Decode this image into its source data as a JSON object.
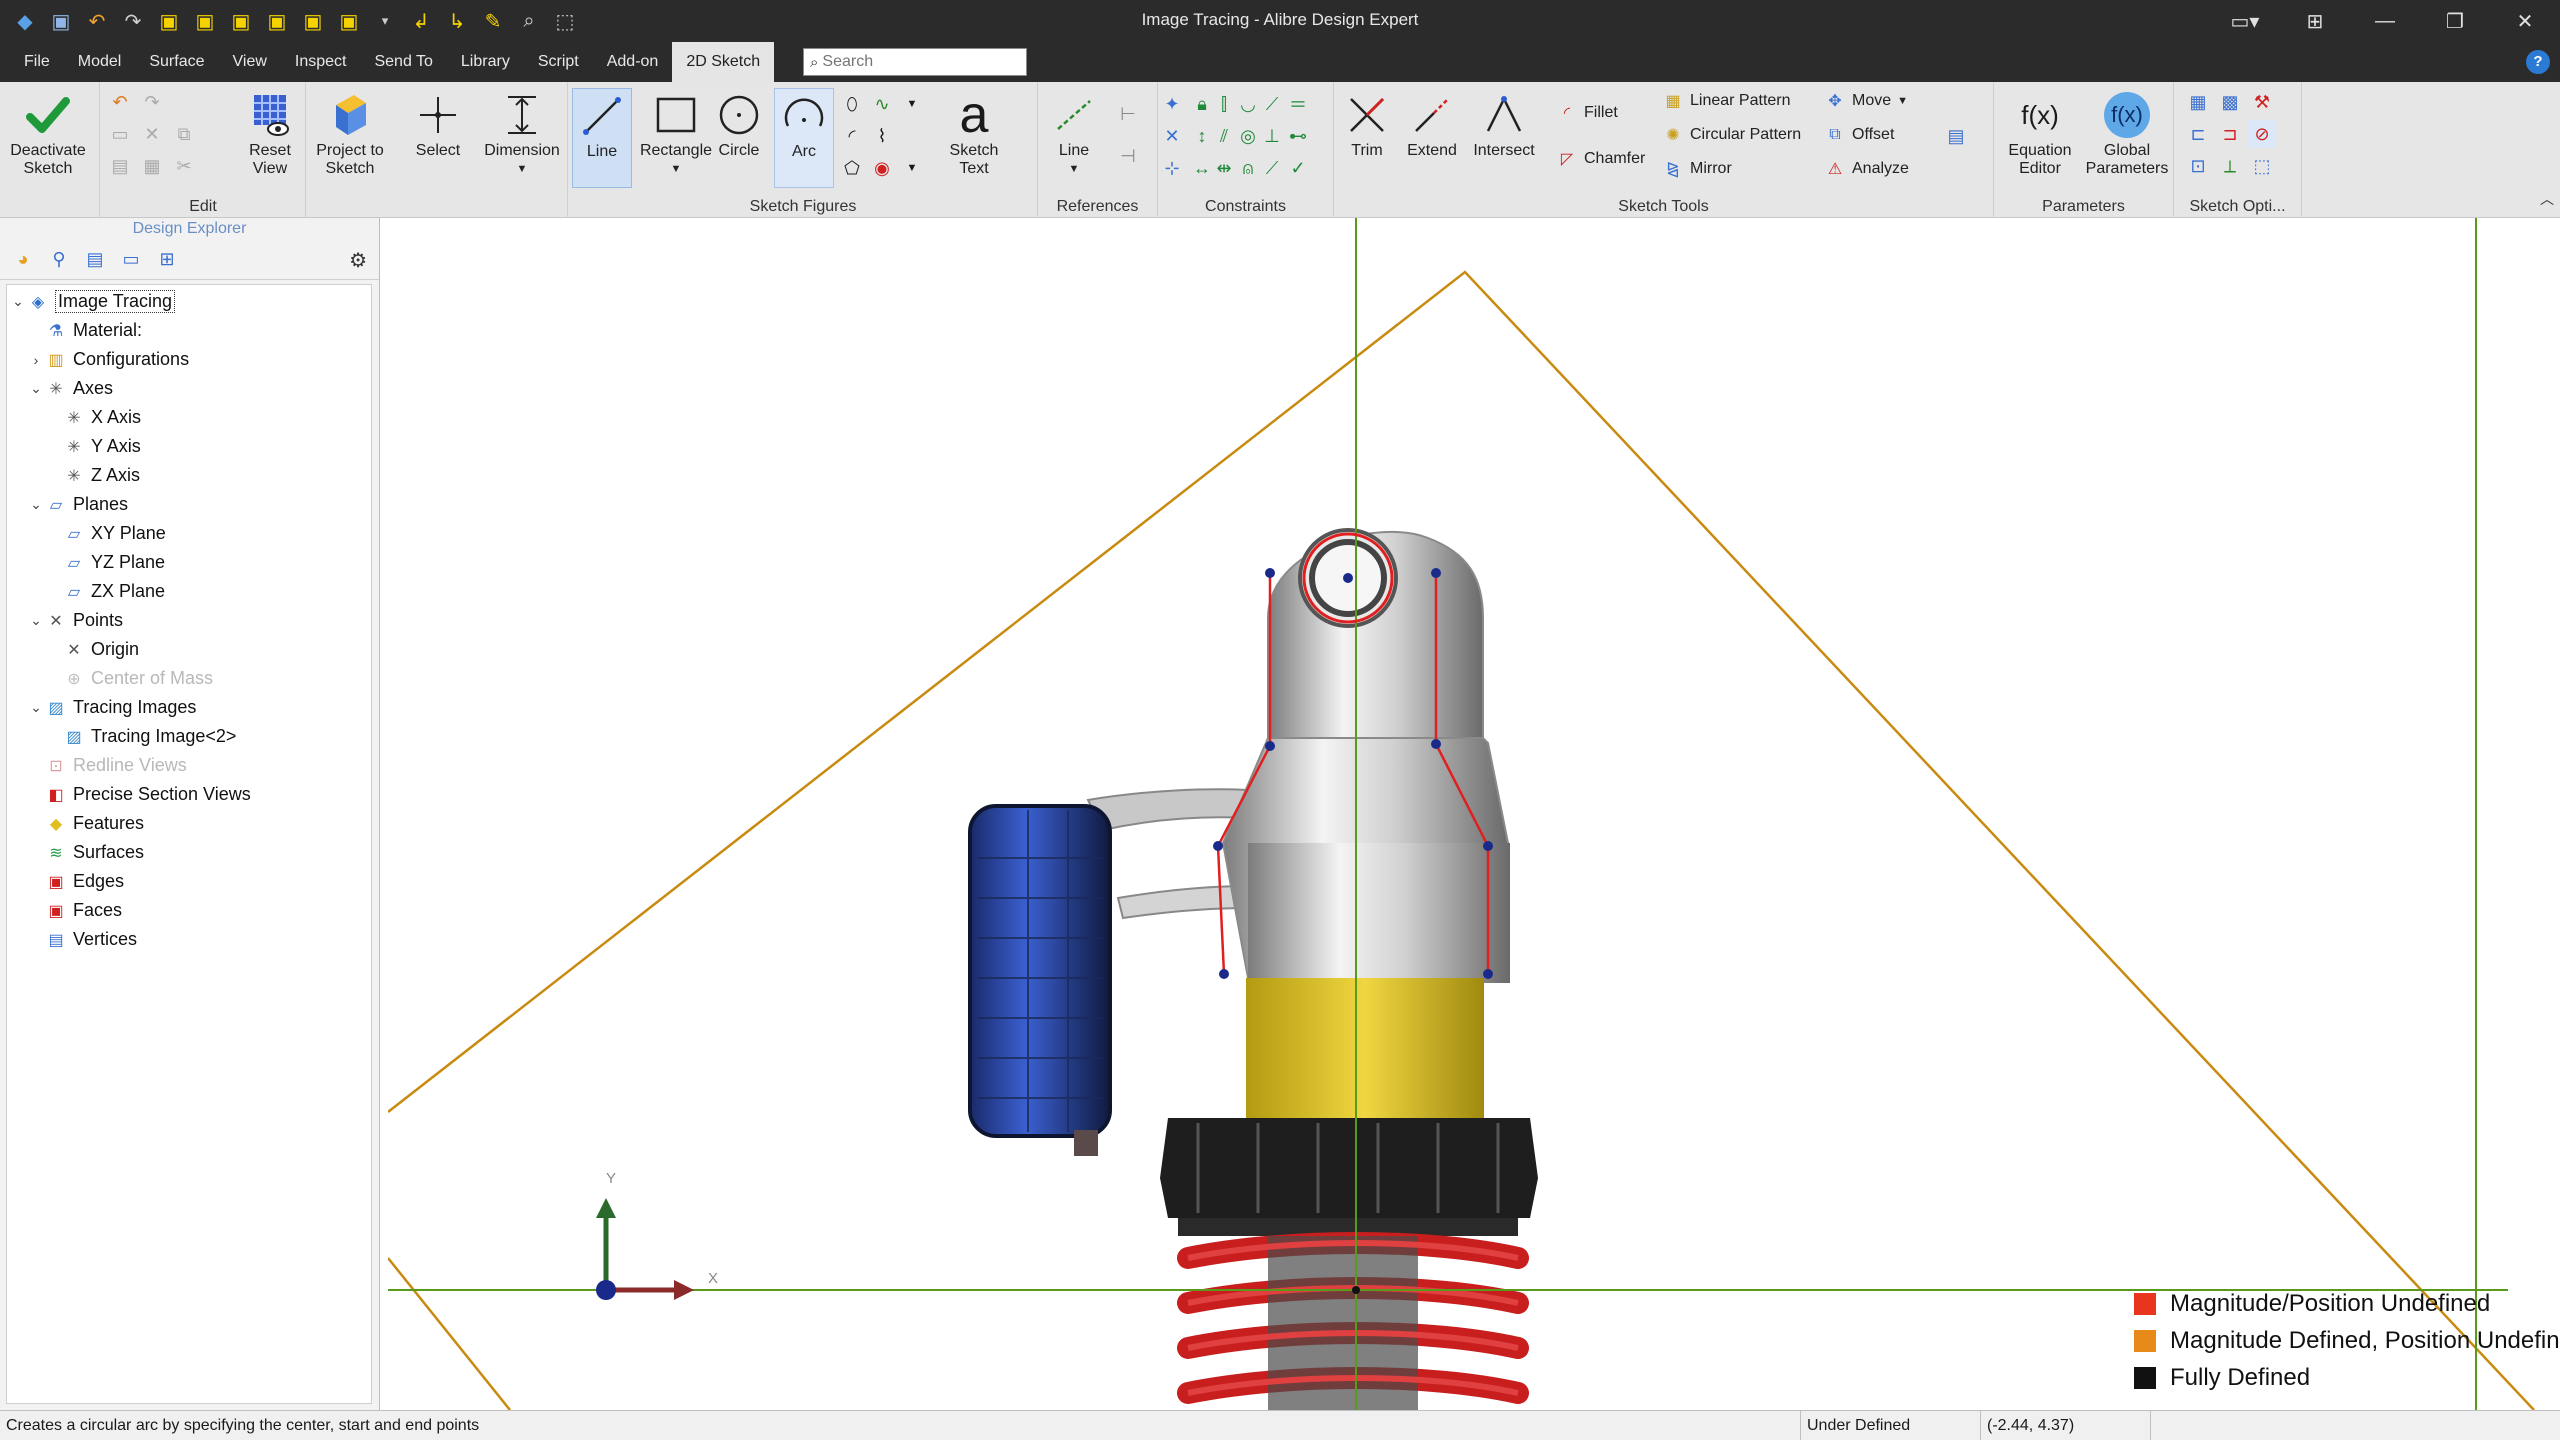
{
  "window": {
    "title": "Image Tracing - Alibre Design Expert"
  },
  "menu": {
    "tabs": [
      "File",
      "Model",
      "Surface",
      "View",
      "Inspect",
      "Send To",
      "Library",
      "Script",
      "Add-on",
      "2D Sketch"
    ],
    "active_tab": "2D Sketch",
    "search_placeholder": "Search"
  },
  "ribbon": {
    "groups": {
      "edit": "Edit",
      "sketch_figures": "Sketch Figures",
      "references": "References",
      "constraints": "Constraints",
      "sketch_tools": "Sketch Tools",
      "parameters": "Parameters",
      "sketch_options": "Sketch Opti..."
    },
    "buttons": {
      "deactivate_sketch": "Deactivate Sketch",
      "reset_view": "Reset View",
      "project_to_sketch": "Project to Sketch",
      "select": "Select",
      "dimension": "Dimension",
      "line": "Line",
      "rectangle": "Rectangle",
      "circle": "Circle",
      "arc": "Arc",
      "sketch_text": "Sketch Text",
      "ref_line": "Line",
      "trim": "Trim",
      "extend": "Extend",
      "intersect": "Intersect",
      "fillet": "Fillet",
      "chamfer": "Chamfer",
      "linear_pattern": "Linear Pattern",
      "circular_pattern": "Circular Pattern",
      "mirror": "Mirror",
      "move": "Move",
      "offset": "Offset",
      "analyze": "Analyze",
      "equation_editor": "Equation Editor",
      "global_parameters": "Global Parameters"
    }
  },
  "explorer": {
    "header": "Design Explorer",
    "tree": [
      {
        "label": "Image Tracing",
        "icon": "part-icon"
      },
      {
        "label": "Material:",
        "icon": "material-icon"
      },
      {
        "label": "Configurations",
        "icon": "configurations-icon"
      },
      {
        "label": "Axes",
        "icon": "axes-icon"
      },
      {
        "label": "X Axis",
        "icon": "axis-icon"
      },
      {
        "label": "Y Axis",
        "icon": "axis-icon"
      },
      {
        "label": "Z Axis",
        "icon": "axis-icon"
      },
      {
        "label": "Planes",
        "icon": "planes-icon"
      },
      {
        "label": "XY Plane",
        "icon": "plane-icon"
      },
      {
        "label": "YZ Plane",
        "icon": "plane-icon"
      },
      {
        "label": "ZX Plane",
        "icon": "plane-icon"
      },
      {
        "label": "Points",
        "icon": "points-icon"
      },
      {
        "label": "Origin",
        "icon": "origin-icon"
      },
      {
        "label": "Center of Mass",
        "icon": "center-of-mass-icon"
      },
      {
        "label": "Tracing Images",
        "icon": "tracing-images-icon"
      },
      {
        "label": "Tracing Image<2>",
        "icon": "tracing-image-icon"
      },
      {
        "label": "Redline Views",
        "icon": "redline-icon"
      },
      {
        "label": "Precise Section Views",
        "icon": "section-icon"
      },
      {
        "label": "Features",
        "icon": "features-icon"
      },
      {
        "label": "Surfaces",
        "icon": "surfaces-icon"
      },
      {
        "label": "Edges",
        "icon": "edges-icon"
      },
      {
        "label": "Faces",
        "icon": "faces-icon"
      },
      {
        "label": "Vertices",
        "icon": "vertices-icon"
      }
    ]
  },
  "viewport": {
    "axis_labels": {
      "y": "Y",
      "x": "X"
    },
    "legend": [
      {
        "label": "Magnitude/Position Undefined",
        "color": "#e8361e"
      },
      {
        "label": "Magnitude Defined, Position Undefined",
        "color": "#e88a1a"
      },
      {
        "label": "Fully Defined",
        "color": "#111111"
      }
    ]
  },
  "status": {
    "message": "Creates a circular arc by specifying the center, start and end points",
    "state": "Under Defined",
    "coords": "(-2.44, 4.37)"
  }
}
